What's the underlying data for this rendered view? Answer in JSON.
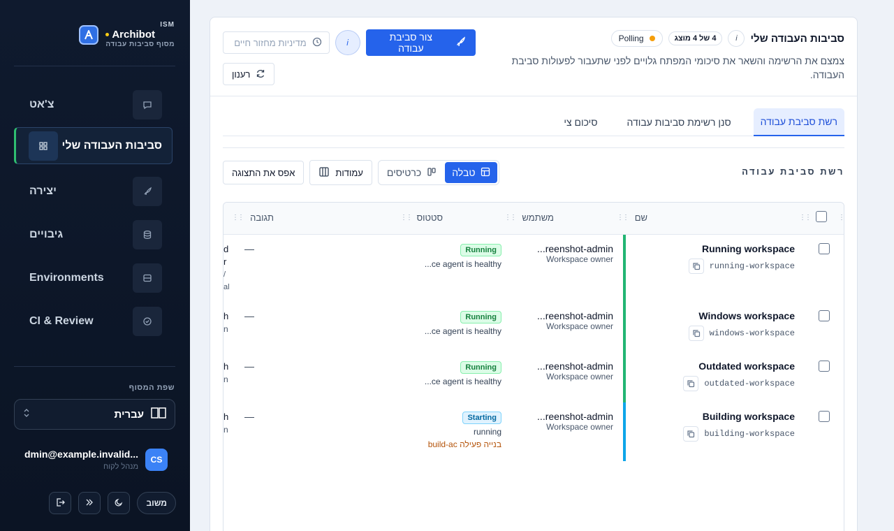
{
  "sidebar": {
    "brand": {
      "tag": "ISM",
      "name": "Archibot",
      "subtitle": "מסוף סביבות עבודה"
    },
    "nav": [
      {
        "label": "צ'אט",
        "icon": "chat-icon"
      },
      {
        "label": "סביבות העבודה שלי",
        "icon": "grid-icon",
        "active": true
      },
      {
        "label": "יצירה",
        "icon": "rocket-icon"
      },
      {
        "label": "גיבויים",
        "icon": "database-icon"
      },
      {
        "label": "Environments",
        "icon": "server-icon"
      },
      {
        "label": "CI & Review",
        "icon": "check-circle-icon"
      }
    ],
    "language": {
      "label": "שפת המסוף",
      "value": "עברית"
    },
    "user": {
      "initials": "CS",
      "name": "dmin@example.invalid...",
      "role": "מנהל לקוח"
    },
    "footer": {
      "feedback": "משוב"
    }
  },
  "header": {
    "title": "סביבות העבודה שלי",
    "count_badge": "4 של 4 מוצג",
    "polling": "Polling",
    "description": "צמצם את הרשימה והשאר את סיכומי המפתח גלויים לפני שתעבור לפעולות סביבת העבודה.",
    "create_button": "צור סביבת עבודה",
    "lifecycle_placeholder": "מדיניות מחזור חיים",
    "refresh_button": "רענון",
    "info_glyph": "i"
  },
  "tabs": [
    {
      "label": "רשת סביבת עבודה",
      "active": true
    },
    {
      "label": "סנן רשימת סביבות עבודה"
    },
    {
      "label": "סיכום צי"
    }
  ],
  "toolbar": {
    "title": "רשת סביבת עבודה",
    "view_table": "טבלה",
    "view_cards": "כרטיסים",
    "columns": "עמודות",
    "reset_view": "אפס את התצוגה"
  },
  "grid": {
    "columns": {
      "name": "שם",
      "user": "משתמש",
      "status": "סטטוס",
      "response": "תגובה"
    },
    "rows": [
      {
        "name": "Running workspace",
        "slug": "running-workspace",
        "user": "reenshot-admin...",
        "user_role": "Workspace owner",
        "status": "Running",
        "status_kind": "running",
        "status_detail": "ce agent is healthy...",
        "status_extra": "",
        "response": "—",
        "bar_color": "#22b573",
        "cut": [
          "d",
          "r",
          "/",
          "al"
        ]
      },
      {
        "name": "Windows workspace",
        "slug": "windows-workspace",
        "user": "reenshot-admin...",
        "user_role": "Workspace owner",
        "status": "Running",
        "status_kind": "running",
        "status_detail": "ce agent is healthy...",
        "status_extra": "",
        "response": "—",
        "bar_color": "#22b573",
        "cut": [
          "h",
          "n"
        ]
      },
      {
        "name": "Outdated workspace",
        "slug": "outdated-workspace",
        "user": "reenshot-admin...",
        "user_role": "Workspace owner",
        "status": "Running",
        "status_kind": "running",
        "status_detail": "ce agent is healthy...",
        "status_extra": "",
        "response": "—",
        "bar_color": "#22b573",
        "cut": [
          "h",
          "n"
        ]
      },
      {
        "name": "Building workspace",
        "slug": "building-workspace",
        "user": "reenshot-admin...",
        "user_role": "Workspace owner",
        "status": "Starting",
        "status_kind": "starting",
        "status_detail": "running",
        "status_extra": "בנייה פעילה build-ac",
        "response": "—",
        "bar_color": "#0ea5e9",
        "cut": [
          "h",
          "n"
        ]
      }
    ]
  }
}
